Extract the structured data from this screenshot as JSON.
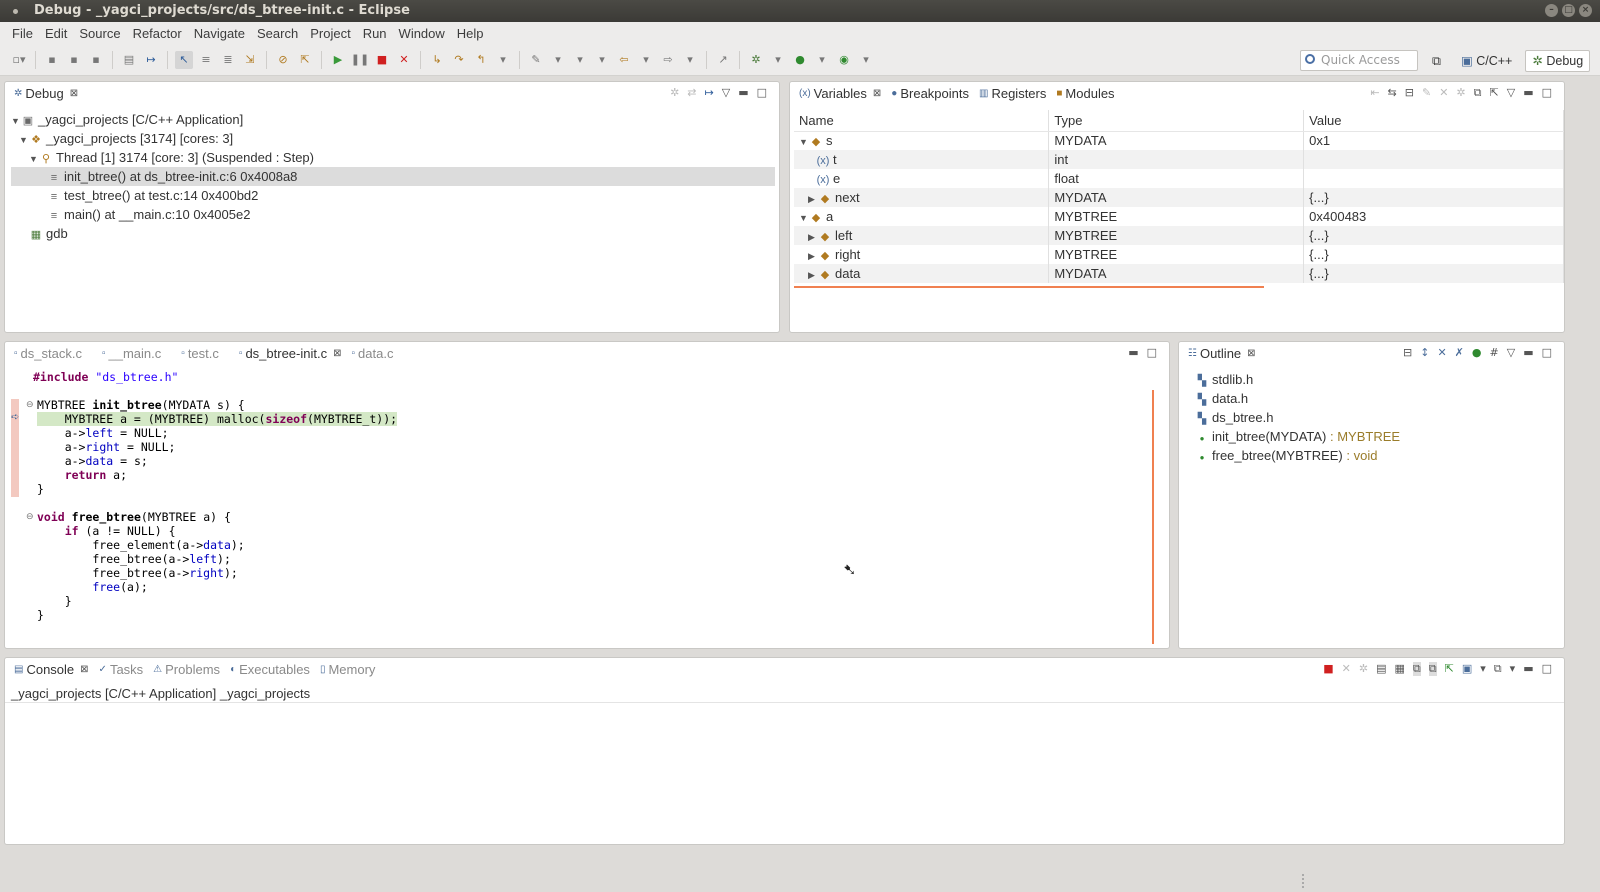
{
  "window": {
    "title": "Debug - _yagci_projects/src/ds_btree-init.c - Eclipse"
  },
  "menu": [
    "File",
    "Edit",
    "Source",
    "Refactor",
    "Navigate",
    "Search",
    "Project",
    "Run",
    "Window",
    "Help"
  ],
  "quick_access": {
    "placeholder": "Quick Access"
  },
  "perspectives": {
    "cpp": "C/C++",
    "debug": "Debug"
  },
  "debug_view": {
    "tab": "Debug",
    "rows": [
      {
        "label": "_yagci_projects [C/C++ Application]"
      },
      {
        "label": "_yagci_projects [3174] [cores: 3]"
      },
      {
        "label": "Thread [1] 3174 [core: 3] (Suspended : Step)"
      },
      {
        "label": "init_btree() at ds_btree-init.c:6 0x4008a8"
      },
      {
        "label": "test_btree() at test.c:14 0x400bd2"
      },
      {
        "label": "main() at __main.c:10 0x4005e2"
      },
      {
        "label": "gdb"
      }
    ]
  },
  "variables_view": {
    "tabs": [
      "Variables",
      "Breakpoints",
      "Registers",
      "Modules"
    ],
    "columns": [
      "Name",
      "Type",
      "Value"
    ],
    "rows": [
      {
        "name": "s",
        "type": "MYDATA",
        "value": "0x1"
      },
      {
        "name": "t",
        "type": "int",
        "value": ""
      },
      {
        "name": "e",
        "type": "float",
        "value": ""
      },
      {
        "name": "next",
        "type": "MYDATA",
        "value": "{...}"
      },
      {
        "name": "a",
        "type": "MYBTREE",
        "value": "0x400483"
      },
      {
        "name": "left",
        "type": "MYBTREE",
        "value": "{...}"
      },
      {
        "name": "right",
        "type": "MYBTREE",
        "value": "{...}"
      },
      {
        "name": "data",
        "type": "MYDATA",
        "value": "{...}"
      }
    ]
  },
  "editor": {
    "tabs": [
      "ds_stack.c",
      "__main.c",
      "test.c",
      "ds_btree-init.c",
      "data.c"
    ],
    "active_tab": "ds_btree-init.c"
  },
  "outline_view": {
    "tab": "Outline",
    "items": [
      {
        "label": "stdlib.h",
        "type": ""
      },
      {
        "label": "data.h",
        "type": ""
      },
      {
        "label": "ds_btree.h",
        "type": ""
      },
      {
        "label": "init_btree(MYDATA)",
        "type": " : MYBTREE"
      },
      {
        "label": "free_btree(MYBTREE)",
        "type": " : void"
      }
    ]
  },
  "console_view": {
    "tabs": [
      "Console",
      "Tasks",
      "Problems",
      "Executables",
      "Memory"
    ],
    "text": "_yagci_projects [C/C++ Application] _yagci_projects"
  }
}
